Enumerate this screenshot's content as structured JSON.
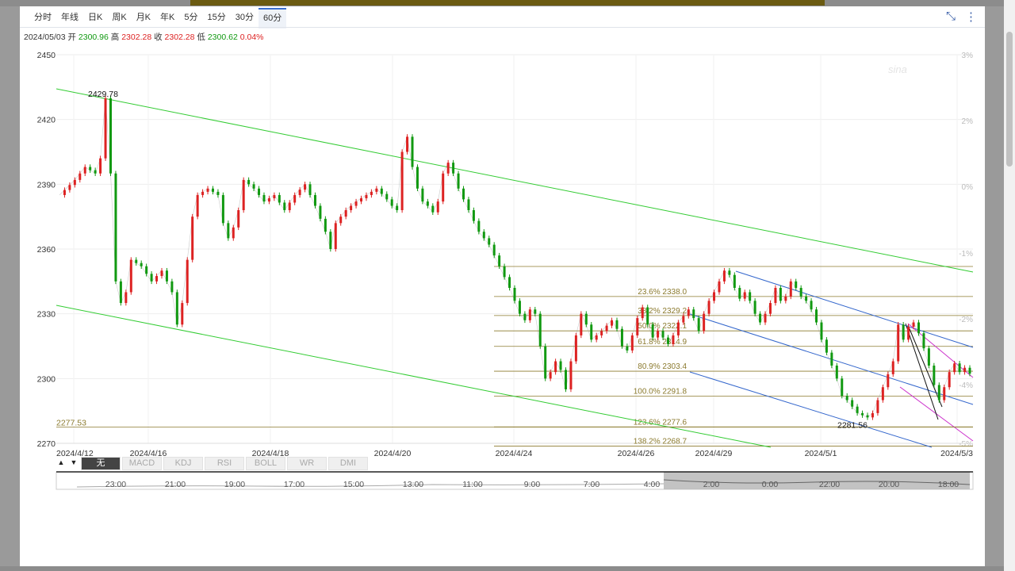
{
  "tabs": [
    "分时",
    "年线",
    "日K",
    "周K",
    "月K",
    "年K",
    "5分",
    "15分",
    "30分",
    "60分"
  ],
  "active_tab": 9,
  "icons": {
    "collapse": "compress-icon",
    "more": "more-vert-icon"
  },
  "quote": {
    "date": "2024/05/03",
    "open_label": "开",
    "open": "2300.96",
    "high_label": "高",
    "high": "2302.28",
    "close_label": "收",
    "close": "2302.28",
    "low_label": "低",
    "low": "2300.62",
    "change": "0.04%"
  },
  "indicators": [
    "无",
    "MACD",
    "KDJ",
    "RSI",
    "BOLL",
    "WR",
    "DMI"
  ],
  "active_indicator": 0,
  "nav_arrows": [
    "▲",
    "▼"
  ],
  "navigator_labels": [
    "23:00",
    "21:00",
    "19:00",
    "17:00",
    "15:00",
    "13:00",
    "11:00",
    "9:00",
    "7:00",
    "4:00",
    "2:00",
    "0:00",
    "22:00",
    "20:00",
    "18:00"
  ],
  "colors": {
    "up": "#dd2222",
    "down": "#119911",
    "channel_green": "#33cc33",
    "channel_blue": "#3366cc",
    "channel_magenta": "#cc33cc",
    "fib": "#8b7a2e"
  },
  "chart_data": {
    "type": "candlestick",
    "ylim": [
      2270,
      2450
    ],
    "y_ticks": [
      "2450",
      "2420",
      "2390",
      "2360",
      "2330",
      "2300",
      "2270"
    ],
    "right_ticks": [
      "3%",
      "2%",
      "0%",
      "-1%",
      "-2%",
      "-4%",
      "-5%"
    ],
    "x_ticks": [
      "2024/4/12",
      "2024/4/16",
      "2024/4/18",
      "2024/4/20",
      "2024/4/24",
      "2024/4/26",
      "2024/4/29",
      "2024/5/1",
      "2024/5/3"
    ],
    "grid": true,
    "annotations": [
      {
        "text": "2429.78",
        "price": 2429.78
      },
      {
        "text": "2277.53",
        "price": 2277.53
      },
      {
        "text": "2281.56",
        "price": 2281.56
      }
    ],
    "fib_levels": [
      {
        "label": "23.6% 2338.0",
        "price": 2338.0
      },
      {
        "label": "38.2% 2329.2",
        "price": 2329.2
      },
      {
        "label": "50.0% 2322.1",
        "price": 2322.1
      },
      {
        "label": "61.8% 2314.9",
        "price": 2314.9
      },
      {
        "label": "80.9% 2303.4",
        "price": 2303.4
      },
      {
        "label": "100.0% 2291.8",
        "price": 2291.8
      },
      {
        "label": "123.6% 2277.6",
        "price": 2277.6
      },
      {
        "label": "138.2% 2268.7",
        "price": 2268.7
      }
    ],
    "series_path": [
      [
        0,
        2385
      ],
      [
        3,
        2392
      ],
      [
        5,
        2398
      ],
      [
        7,
        2395
      ],
      [
        8,
        2402
      ],
      [
        9,
        2429.78
      ],
      [
        10,
        2395
      ],
      [
        11,
        2345
      ],
      [
        12,
        2335
      ],
      [
        13,
        2340
      ],
      [
        14,
        2355
      ],
      [
        16,
        2352
      ],
      [
        18,
        2345
      ],
      [
        20,
        2350
      ],
      [
        22,
        2340
      ],
      [
        23,
        2325
      ],
      [
        24,
        2335
      ],
      [
        25,
        2355
      ],
      [
        26,
        2375
      ],
      [
        27,
        2385
      ],
      [
        29,
        2388
      ],
      [
        31,
        2385
      ],
      [
        32,
        2372
      ],
      [
        33,
        2365
      ],
      [
        34,
        2370
      ],
      [
        35,
        2378
      ],
      [
        36,
        2392
      ],
      [
        38,
        2388
      ],
      [
        40,
        2382
      ],
      [
        42,
        2385
      ],
      [
        44,
        2378
      ],
      [
        46,
        2385
      ],
      [
        48,
        2390
      ],
      [
        50,
        2380
      ],
      [
        52,
        2368
      ],
      [
        53,
        2360
      ],
      [
        54,
        2372
      ],
      [
        56,
        2378
      ],
      [
        58,
        2382
      ],
      [
        60,
        2385
      ],
      [
        62,
        2388
      ],
      [
        64,
        2383
      ],
      [
        65,
        2380
      ],
      [
        66,
        2378
      ],
      [
        67,
        2405
      ],
      [
        68,
        2412
      ],
      [
        69,
        2398
      ],
      [
        70,
        2388
      ],
      [
        71,
        2382
      ],
      [
        72,
        2380
      ],
      [
        73,
        2377
      ],
      [
        74,
        2382
      ],
      [
        75,
        2395
      ],
      [
        76,
        2400
      ],
      [
        77,
        2395
      ],
      [
        78,
        2388
      ],
      [
        80,
        2378
      ],
      [
        82,
        2368
      ],
      [
        84,
        2362
      ],
      [
        86,
        2352
      ],
      [
        88,
        2342
      ],
      [
        89,
        2336
      ],
      [
        90,
        2330
      ],
      [
        91,
        2327
      ],
      [
        92,
        2332
      ],
      [
        93,
        2330
      ],
      [
        94,
        2315
      ],
      [
        95,
        2300
      ],
      [
        96,
        2303
      ],
      [
        97,
        2308
      ],
      [
        98,
        2304
      ],
      [
        99,
        2295
      ],
      [
        100,
        2308
      ],
      [
        101,
        2320
      ],
      [
        102,
        2330
      ],
      [
        103,
        2325
      ],
      [
        104,
        2318
      ],
      [
        106,
        2322
      ],
      [
        108,
        2327
      ],
      [
        109,
        2323
      ],
      [
        110,
        2315
      ],
      [
        111,
        2313
      ],
      [
        112,
        2320
      ],
      [
        113,
        2328
      ],
      [
        114,
        2333
      ],
      [
        115,
        2325
      ],
      [
        116,
        2319
      ],
      [
        117,
        2322
      ],
      [
        118,
        2319
      ],
      [
        119,
        2316
      ],
      [
        120,
        2320
      ],
      [
        121,
        2326
      ],
      [
        122,
        2329
      ],
      [
        123,
        2332
      ],
      [
        124,
        2328
      ],
      [
        125,
        2322
      ],
      [
        126,
        2330
      ],
      [
        127,
        2336
      ],
      [
        128,
        2340
      ],
      [
        129,
        2345
      ],
      [
        130,
        2350
      ],
      [
        131,
        2348
      ],
      [
        132,
        2342
      ],
      [
        133,
        2337
      ],
      [
        134,
        2340
      ],
      [
        135,
        2336
      ],
      [
        136,
        2330
      ],
      [
        137,
        2326
      ],
      [
        138,
        2330
      ],
      [
        139,
        2335
      ],
      [
        140,
        2342
      ],
      [
        141,
        2336
      ],
      [
        142,
        2338
      ],
      [
        143,
        2345
      ],
      [
        144,
        2342
      ],
      [
        145,
        2338
      ],
      [
        146,
        2336
      ],
      [
        147,
        2332
      ],
      [
        148,
        2326
      ],
      [
        149,
        2318
      ],
      [
        150,
        2312
      ],
      [
        151,
        2306
      ],
      [
        152,
        2300
      ],
      [
        153,
        2292
      ],
      [
        154,
        2290
      ],
      [
        155,
        2287
      ],
      [
        156,
        2284
      ],
      [
        157,
        2283
      ],
      [
        158,
        2282
      ],
      [
        159,
        2284
      ],
      [
        160,
        2290
      ],
      [
        161,
        2296
      ],
      [
        162,
        2302
      ],
      [
        163,
        2308
      ],
      [
        164,
        2325
      ],
      [
        165,
        2318
      ],
      [
        166,
        2324
      ],
      [
        167,
        2326
      ],
      [
        168,
        2321
      ],
      [
        169,
        2314
      ],
      [
        170,
        2306
      ],
      [
        171,
        2297
      ],
      [
        172,
        2290
      ],
      [
        173,
        2296
      ],
      [
        174,
        2303
      ],
      [
        175,
        2307
      ],
      [
        176,
        2303
      ],
      [
        177,
        2305
      ],
      [
        178,
        2302.28
      ]
    ]
  }
}
